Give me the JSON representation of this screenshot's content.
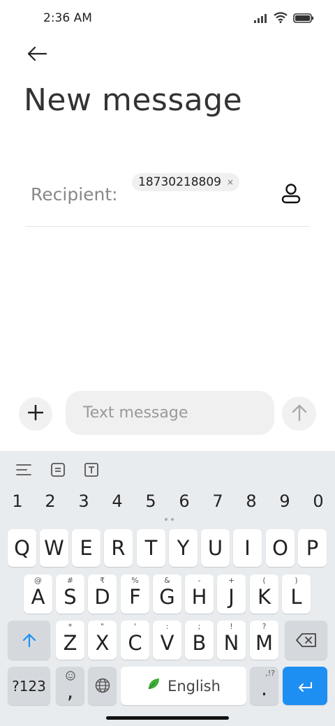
{
  "status": {
    "time": "2:36 AM"
  },
  "header": {
    "title": "New message"
  },
  "recipient": {
    "label": "Recipient:",
    "chip_value": "18730218809",
    "chip_remove": "×"
  },
  "composer": {
    "placeholder": "Text message"
  },
  "keyboard": {
    "numbers": [
      "1",
      "2",
      "3",
      "4",
      "5",
      "6",
      "7",
      "8",
      "9",
      "0"
    ],
    "row1": [
      "Q",
      "W",
      "E",
      "R",
      "T",
      "Y",
      "U",
      "I",
      "O",
      "P"
    ],
    "row2": [
      {
        "key": "A",
        "hint": "@"
      },
      {
        "key": "S",
        "hint": "#"
      },
      {
        "key": "D",
        "hint": "₹"
      },
      {
        "key": "F",
        "hint": "%"
      },
      {
        "key": "G",
        "hint": "&"
      },
      {
        "key": "H",
        "hint": "-"
      },
      {
        "key": "J",
        "hint": "+"
      },
      {
        "key": "K",
        "hint": "("
      },
      {
        "key": "L",
        "hint": ")"
      }
    ],
    "row3": [
      {
        "key": "Z",
        "hint": "*"
      },
      {
        "key": "X",
        "hint": "\""
      },
      {
        "key": "C",
        "hint": "'"
      },
      {
        "key": "V",
        "hint": ":"
      },
      {
        "key": "B",
        "hint": ";"
      },
      {
        "key": "N",
        "hint": "!"
      },
      {
        "key": "M",
        "hint": "?"
      }
    ],
    "symbols_label": "?123",
    "comma": ",",
    "space_label": "English",
    "period": ".",
    "period_hint": ",!?",
    "accent_color": "#1e8ff2"
  }
}
